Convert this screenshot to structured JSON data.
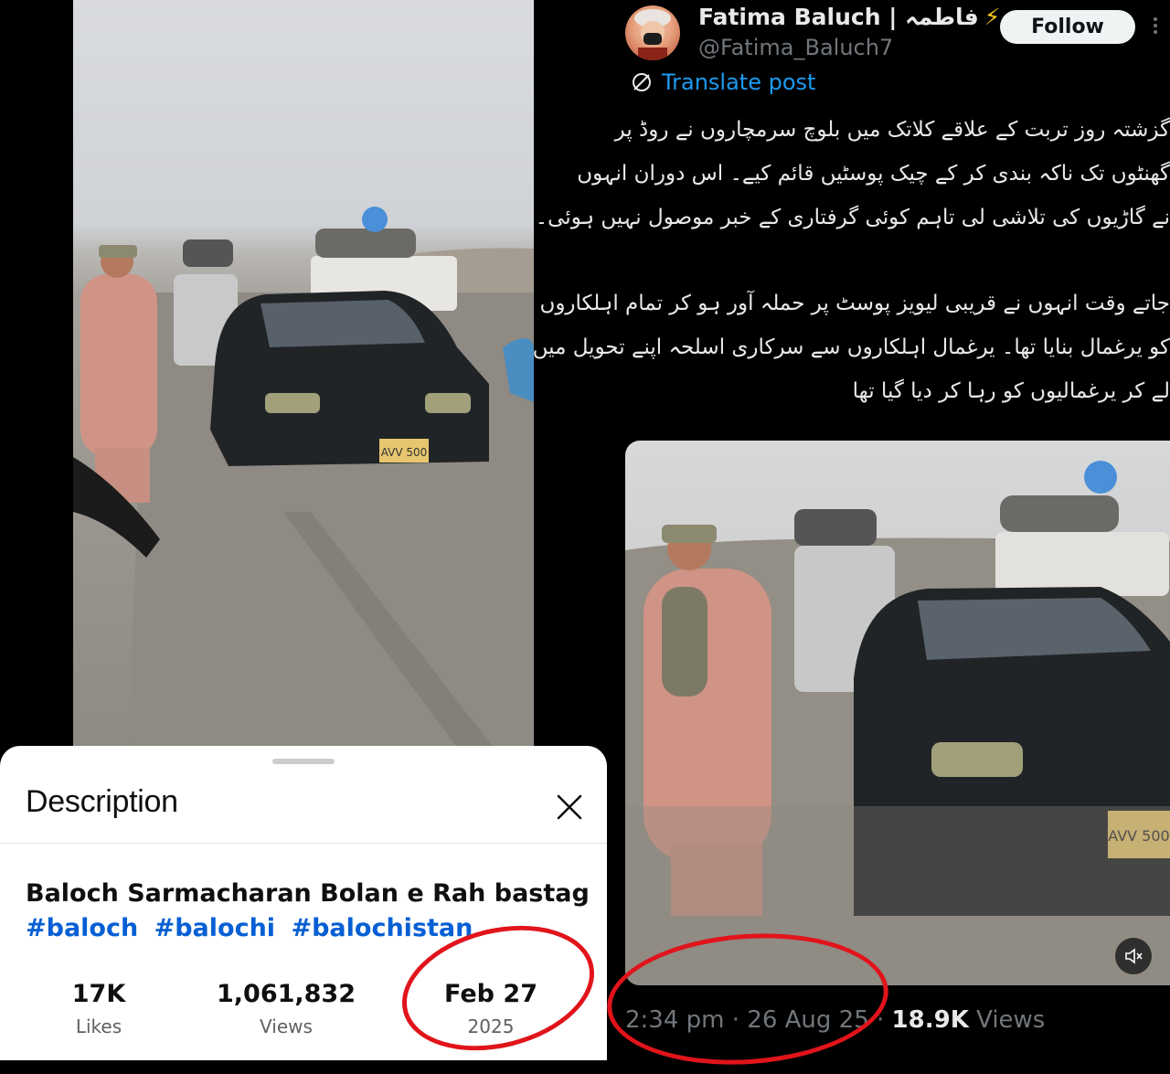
{
  "youtube": {
    "description_heading": "Description",
    "video_title": "Baloch Sarmacharan Bolan e Rah bastag",
    "hashtags": [
      "#baloch",
      "#balochi",
      "#balochistan"
    ],
    "stats": {
      "likes_value": "17K",
      "likes_label": "Likes",
      "views_value": "1,061,832",
      "views_label": "Views",
      "date_value": "Feb 27",
      "date_year": "2025"
    },
    "plate_text": "AVV 500"
  },
  "tweet": {
    "author_name": "Fatima Baluch | فاطمہ",
    "author_handle": "@Fatima_Baluch7",
    "follow_label": "Follow",
    "translate_label": "Translate post",
    "paragraph1": [
      "گزشتہ روز تربت کے علاقے کلاتک میں بلوچ سرمچاروں نے روڈ پر",
      "گھنٹوں تک ناکہ بندی کر کے چیک پوسٹیں قائم کیے۔ اس دوران انہوں",
      "نے گاڑیوں کی تلاشی لی تاہم کوئی گرفتاری کے خبر موصول نہیں ہوئی۔"
    ],
    "paragraph2": [
      "جاتے وقت انہوں نے قریبی لیویز پوسٹ پر حملہ آور ہو کر تمام اہلکاروں",
      "کو یرغمال بنایا تھا۔ یرغمال اہلکاروں سے سرکاری اسلحہ اپنے تحویل میں",
      "لے کر یرغمالیوں کو رہا کر دیا گیا تھا"
    ],
    "meta_time": "2:34 pm · 26 Aug 25 · ",
    "meta_views_count": "18.9K",
    "meta_views_label": " Views",
    "media_plate_text": "AVV 500"
  },
  "colors": {
    "annotation_red": "#e1141b",
    "youtube_link": "#065fd4",
    "x_blue": "#1d9bf0"
  }
}
